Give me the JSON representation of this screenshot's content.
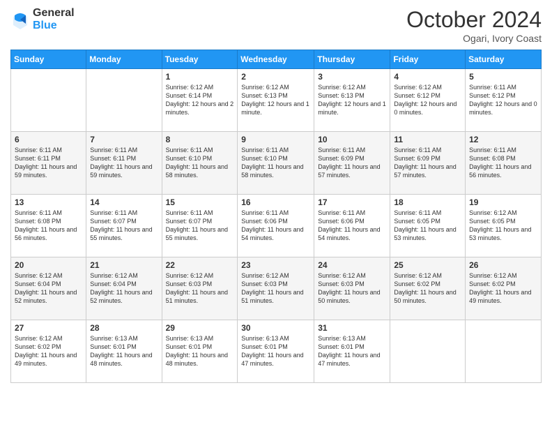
{
  "logo": {
    "general": "General",
    "blue": "Blue"
  },
  "header": {
    "month": "October 2024",
    "location": "Ogari, Ivory Coast"
  },
  "weekdays": [
    "Sunday",
    "Monday",
    "Tuesday",
    "Wednesday",
    "Thursday",
    "Friday",
    "Saturday"
  ],
  "weeks": [
    [
      {
        "day": "",
        "info": ""
      },
      {
        "day": "",
        "info": ""
      },
      {
        "day": "1",
        "info": "Sunrise: 6:12 AM\nSunset: 6:14 PM\nDaylight: 12 hours and 2 minutes."
      },
      {
        "day": "2",
        "info": "Sunrise: 6:12 AM\nSunset: 6:13 PM\nDaylight: 12 hours and 1 minute."
      },
      {
        "day": "3",
        "info": "Sunrise: 6:12 AM\nSunset: 6:13 PM\nDaylight: 12 hours and 1 minute."
      },
      {
        "day": "4",
        "info": "Sunrise: 6:12 AM\nSunset: 6:12 PM\nDaylight: 12 hours and 0 minutes."
      },
      {
        "day": "5",
        "info": "Sunrise: 6:11 AM\nSunset: 6:12 PM\nDaylight: 12 hours and 0 minutes."
      }
    ],
    [
      {
        "day": "6",
        "info": "Sunrise: 6:11 AM\nSunset: 6:11 PM\nDaylight: 11 hours and 59 minutes."
      },
      {
        "day": "7",
        "info": "Sunrise: 6:11 AM\nSunset: 6:11 PM\nDaylight: 11 hours and 59 minutes."
      },
      {
        "day": "8",
        "info": "Sunrise: 6:11 AM\nSunset: 6:10 PM\nDaylight: 11 hours and 58 minutes."
      },
      {
        "day": "9",
        "info": "Sunrise: 6:11 AM\nSunset: 6:10 PM\nDaylight: 11 hours and 58 minutes."
      },
      {
        "day": "10",
        "info": "Sunrise: 6:11 AM\nSunset: 6:09 PM\nDaylight: 11 hours and 57 minutes."
      },
      {
        "day": "11",
        "info": "Sunrise: 6:11 AM\nSunset: 6:09 PM\nDaylight: 11 hours and 57 minutes."
      },
      {
        "day": "12",
        "info": "Sunrise: 6:11 AM\nSunset: 6:08 PM\nDaylight: 11 hours and 56 minutes."
      }
    ],
    [
      {
        "day": "13",
        "info": "Sunrise: 6:11 AM\nSunset: 6:08 PM\nDaylight: 11 hours and 56 minutes."
      },
      {
        "day": "14",
        "info": "Sunrise: 6:11 AM\nSunset: 6:07 PM\nDaylight: 11 hours and 55 minutes."
      },
      {
        "day": "15",
        "info": "Sunrise: 6:11 AM\nSunset: 6:07 PM\nDaylight: 11 hours and 55 minutes."
      },
      {
        "day": "16",
        "info": "Sunrise: 6:11 AM\nSunset: 6:06 PM\nDaylight: 11 hours and 54 minutes."
      },
      {
        "day": "17",
        "info": "Sunrise: 6:11 AM\nSunset: 6:06 PM\nDaylight: 11 hours and 54 minutes."
      },
      {
        "day": "18",
        "info": "Sunrise: 6:11 AM\nSunset: 6:05 PM\nDaylight: 11 hours and 53 minutes."
      },
      {
        "day": "19",
        "info": "Sunrise: 6:12 AM\nSunset: 6:05 PM\nDaylight: 11 hours and 53 minutes."
      }
    ],
    [
      {
        "day": "20",
        "info": "Sunrise: 6:12 AM\nSunset: 6:04 PM\nDaylight: 11 hours and 52 minutes."
      },
      {
        "day": "21",
        "info": "Sunrise: 6:12 AM\nSunset: 6:04 PM\nDaylight: 11 hours and 52 minutes."
      },
      {
        "day": "22",
        "info": "Sunrise: 6:12 AM\nSunset: 6:03 PM\nDaylight: 11 hours and 51 minutes."
      },
      {
        "day": "23",
        "info": "Sunrise: 6:12 AM\nSunset: 6:03 PM\nDaylight: 11 hours and 51 minutes."
      },
      {
        "day": "24",
        "info": "Sunrise: 6:12 AM\nSunset: 6:03 PM\nDaylight: 11 hours and 50 minutes."
      },
      {
        "day": "25",
        "info": "Sunrise: 6:12 AM\nSunset: 6:02 PM\nDaylight: 11 hours and 50 minutes."
      },
      {
        "day": "26",
        "info": "Sunrise: 6:12 AM\nSunset: 6:02 PM\nDaylight: 11 hours and 49 minutes."
      }
    ],
    [
      {
        "day": "27",
        "info": "Sunrise: 6:12 AM\nSunset: 6:02 PM\nDaylight: 11 hours and 49 minutes."
      },
      {
        "day": "28",
        "info": "Sunrise: 6:13 AM\nSunset: 6:01 PM\nDaylight: 11 hours and 48 minutes."
      },
      {
        "day": "29",
        "info": "Sunrise: 6:13 AM\nSunset: 6:01 PM\nDaylight: 11 hours and 48 minutes."
      },
      {
        "day": "30",
        "info": "Sunrise: 6:13 AM\nSunset: 6:01 PM\nDaylight: 11 hours and 47 minutes."
      },
      {
        "day": "31",
        "info": "Sunrise: 6:13 AM\nSunset: 6:01 PM\nDaylight: 11 hours and 47 minutes."
      },
      {
        "day": "",
        "info": ""
      },
      {
        "day": "",
        "info": ""
      }
    ]
  ]
}
